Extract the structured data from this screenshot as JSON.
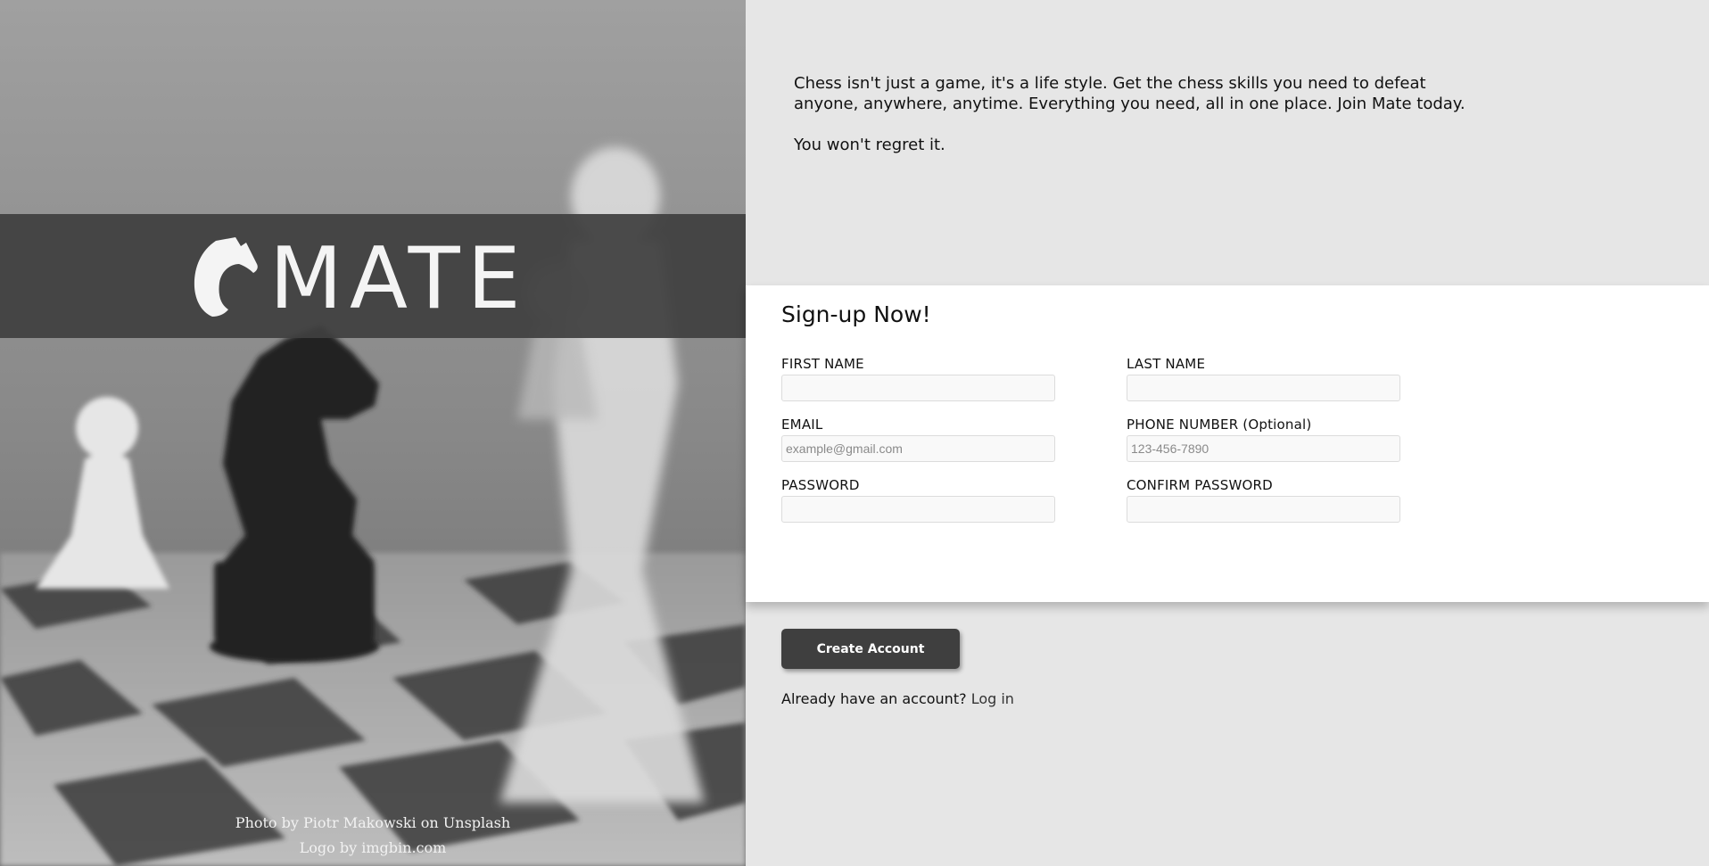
{
  "brand": {
    "logo_text": "MATE"
  },
  "hero": {
    "credit_photo": "Photo by Piotr Makowski on Unsplash",
    "credit_logo": "Logo by imgbin.com"
  },
  "intro": {
    "paragraph_1": "Chess isn't just a game, it's a life style. Get the chess skills you need to defeat anyone, anywhere, anytime. Everything you need, all in one place. Join Mate today.",
    "paragraph_2": "You won't regret it."
  },
  "form": {
    "title": "Sign-up Now!",
    "first_name": {
      "label": "FIRST NAME",
      "placeholder": ""
    },
    "last_name": {
      "label": "LAST NAME",
      "placeholder": ""
    },
    "email": {
      "label": "EMAIL",
      "placeholder": "example@gmail.com"
    },
    "phone": {
      "label": "PHONE NUMBER (Optional)",
      "placeholder": "123-456-7890"
    },
    "password": {
      "label": "PASSWORD",
      "placeholder": ""
    },
    "confirm_password": {
      "label": "CONFIRM PASSWORD",
      "placeholder": ""
    }
  },
  "actions": {
    "create_account": "Create Account",
    "login_prompt": "Already have an account?",
    "login_link": "Log in"
  },
  "colors": {
    "band": "#404040",
    "button": "#3f3f3f",
    "page_bg": "#e6e6e6",
    "card_bg": "#ffffff"
  },
  "icons": {
    "logo": "chess-knight-icon"
  }
}
